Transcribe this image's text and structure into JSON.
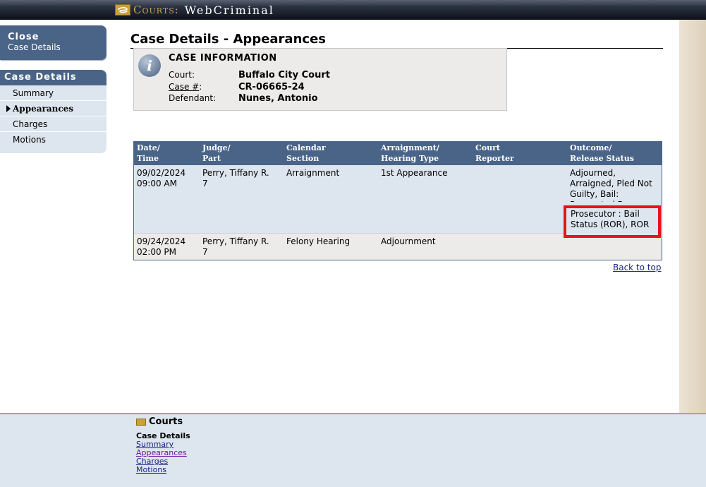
{
  "brand": {
    "courts_label": "Courts:",
    "app_name": "WebCriminal"
  },
  "sidebar": {
    "close_line1": "Close",
    "close_line2": "Case Details",
    "section_title": "Case Details",
    "items": [
      {
        "label": "Summary",
        "active": false
      },
      {
        "label": "Appearances",
        "active": true
      },
      {
        "label": "Charges",
        "active": false
      },
      {
        "label": "Motions",
        "active": false
      }
    ]
  },
  "page": {
    "title": "Case Details - Appearances"
  },
  "case_info": {
    "heading": "CASE INFORMATION",
    "court_label": "Court:",
    "court_value": "Buffalo City Court",
    "case_label_prefix": "Case #",
    "case_label_suffix": ":",
    "case_value": "CR-06665-24",
    "defendant_label": "Defendant:",
    "defendant_value": "Nunes, Antonio"
  },
  "table": {
    "headers": [
      {
        "line1": "Date/",
        "line2": "Time"
      },
      {
        "line1": "Judge/",
        "line2": "Part"
      },
      {
        "line1": "Calendar",
        "line2": "Section"
      },
      {
        "line1": "Arraignment/",
        "line2": "Hearing Type"
      },
      {
        "line1": "Court",
        "line2": "Reporter"
      },
      {
        "line1": "Outcome/",
        "line2": "Release Status"
      }
    ],
    "rows": [
      {
        "date": "09/02/2024",
        "time": "09:00 AM",
        "judge": "Perry, Tiffany R.",
        "part": "7",
        "calendar": "Arraignment",
        "hearing_type": "1st Appearance",
        "reporter": "",
        "outcome_top": "Adjourned, Arraigned, Pled Not Guilty, Bail: Requested By",
        "outcome_highlight": "Prosecutor : Bail Status (ROR), ROR"
      },
      {
        "date": "09/24/2024",
        "time": "02:00 PM",
        "judge": "Perry, Tiffany R.",
        "part": "7",
        "calendar": "Felony Hearing",
        "hearing_type": "Adjournment",
        "reporter": "",
        "outcome_top": ""
      }
    ]
  },
  "back_to_top": "Back to top",
  "footer": {
    "brand": "Courts",
    "section": "Case Details",
    "links": [
      "Summary",
      "Appearances",
      "Charges",
      "Motions"
    ]
  },
  "colors": {
    "nav_blue": "#4a6488",
    "highlight_red": "#e4141b",
    "row_blue": "#dde5ee",
    "row_gray": "#ecebea"
  }
}
